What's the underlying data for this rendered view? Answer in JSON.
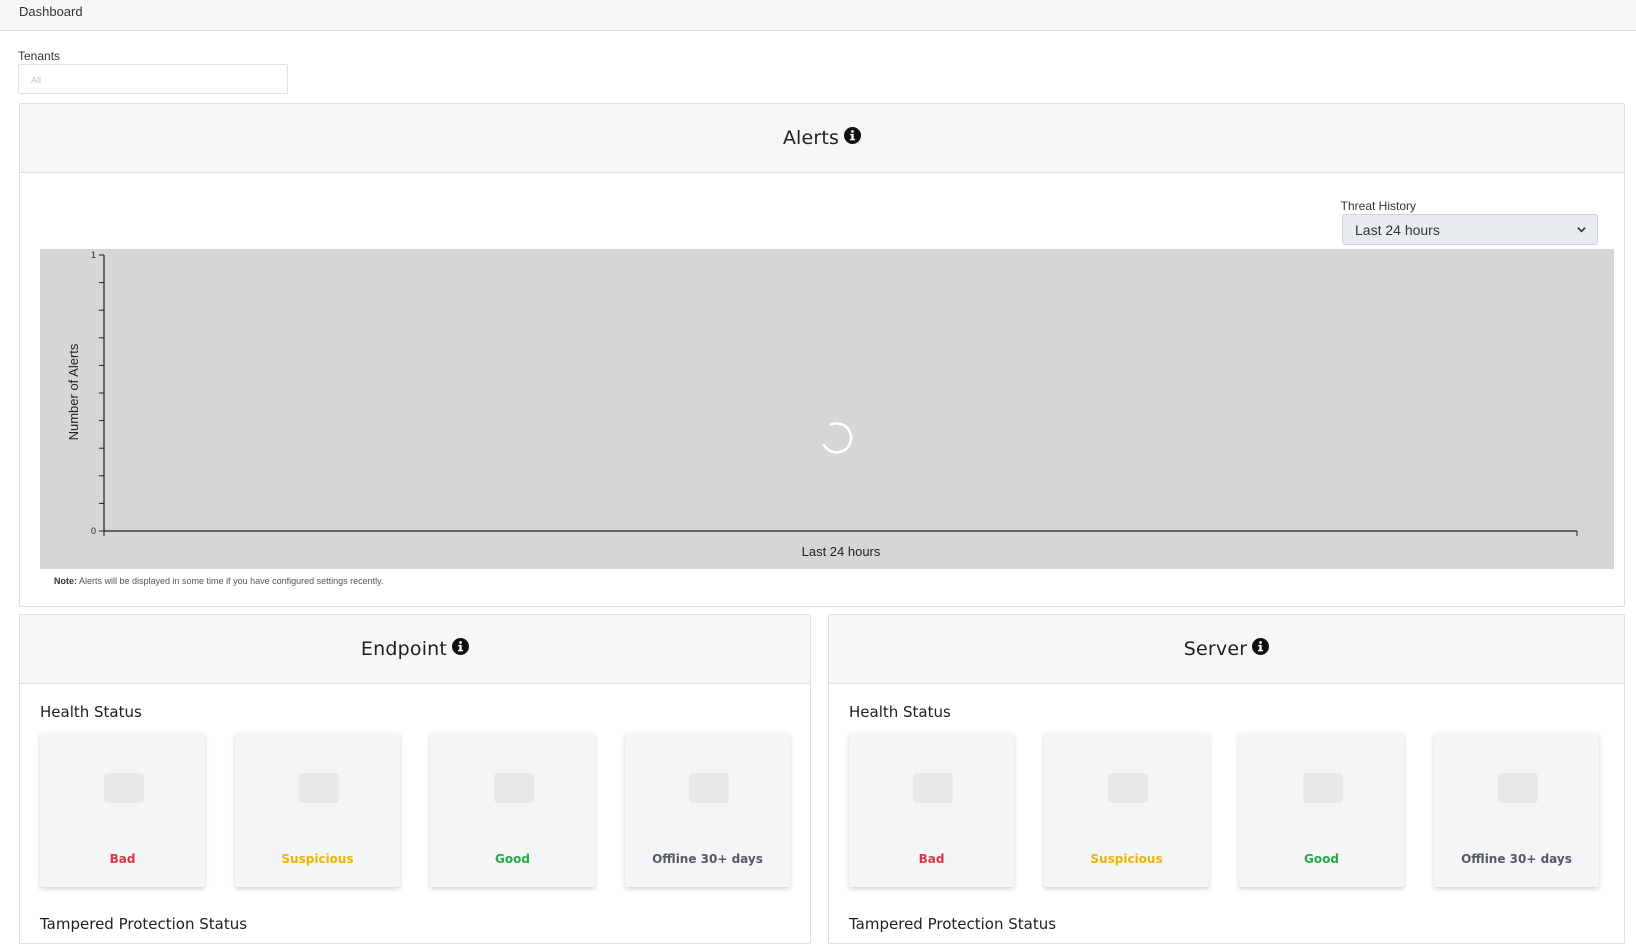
{
  "header": {
    "title": "Dashboard"
  },
  "tenants": {
    "label": "Tenants",
    "placeholder": "All"
  },
  "alerts": {
    "title": "Alerts",
    "threat_history": {
      "label": "Threat History",
      "selected": "Last 24 hours"
    },
    "note_bold": "Note:",
    "note_text": " Alerts will be displayed in some time if you have configured settings recently.",
    "chart_data": {
      "type": "line",
      "ylabel": "Number of Alerts",
      "xlabel": "Last 24 hours",
      "ylim": [
        0,
        1
      ],
      "y_tick_labels": [
        "1",
        "0"
      ],
      "series": [],
      "loading": true
    }
  },
  "endpoint": {
    "title": "Endpoint",
    "health_label": "Health Status",
    "tampered_label": "Tampered Protection Status",
    "tiles": [
      {
        "label": "Bad",
        "color": "#dc3545"
      },
      {
        "label": "Suspicious",
        "color": "#f0b400"
      },
      {
        "label": "Good",
        "color": "#28a745"
      },
      {
        "label": "Offline 30+ days",
        "color": "#555a60"
      }
    ]
  },
  "server": {
    "title": "Server",
    "health_label": "Health Status",
    "tampered_label": "Tampered Protection Status",
    "tiles": [
      {
        "label": "Bad",
        "color": "#dc3545"
      },
      {
        "label": "Suspicious",
        "color": "#f0b400"
      },
      {
        "label": "Good",
        "color": "#28a745"
      },
      {
        "label": "Offline 30+ days",
        "color": "#555a60"
      }
    ]
  }
}
